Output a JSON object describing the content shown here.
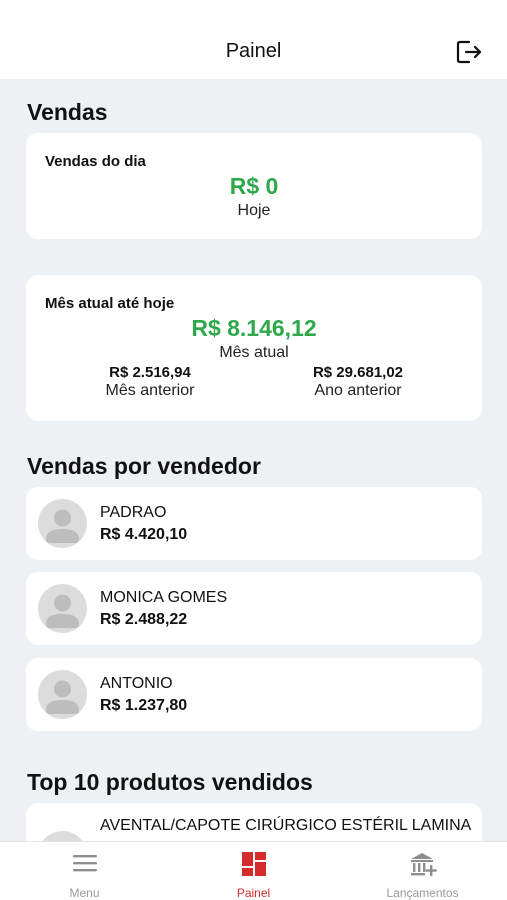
{
  "header": {
    "title": "Painel",
    "logout_icon": "logout-icon"
  },
  "sections": {
    "sales_title": "Vendas",
    "sellers_title": "Vendas por vendedor",
    "top_products_title": "Top 10 produtos vendidos"
  },
  "day_card": {
    "label": "Vendas do dia",
    "value": "R$ 0",
    "caption": "Hoje"
  },
  "month_card": {
    "label": "Mês atual até hoje",
    "value": "R$ 8.146,12",
    "caption": "Mês atual",
    "prev_month_value": "R$ 2.516,94",
    "prev_month_label": "Mês anterior",
    "prev_year_value": "R$ 29.681,02",
    "prev_year_label": "Ano anterior"
  },
  "sellers": [
    {
      "name": "PADRAO",
      "value": "R$ 4.420,10"
    },
    {
      "name": "MONICA GOMES",
      "value": "R$ 2.488,22"
    },
    {
      "name": "ANTONIO",
      "value": "R$ 1.237,80"
    }
  ],
  "products": [
    {
      "name": "AVENTAL/CAPOTE CIRÚRGICO ESTÉRIL LAMINA"
    }
  ],
  "tabbar": {
    "items": [
      {
        "label": "Menu",
        "icon": "menu-icon"
      },
      {
        "label": "Painel",
        "icon": "dashboard-icon",
        "active": true
      },
      {
        "label": "Lançamentos",
        "icon": "bank-add-icon"
      }
    ]
  },
  "colors": {
    "accent_green": "#2ea84a",
    "active_red": "#d62b2b",
    "background": "#eef1f4"
  }
}
